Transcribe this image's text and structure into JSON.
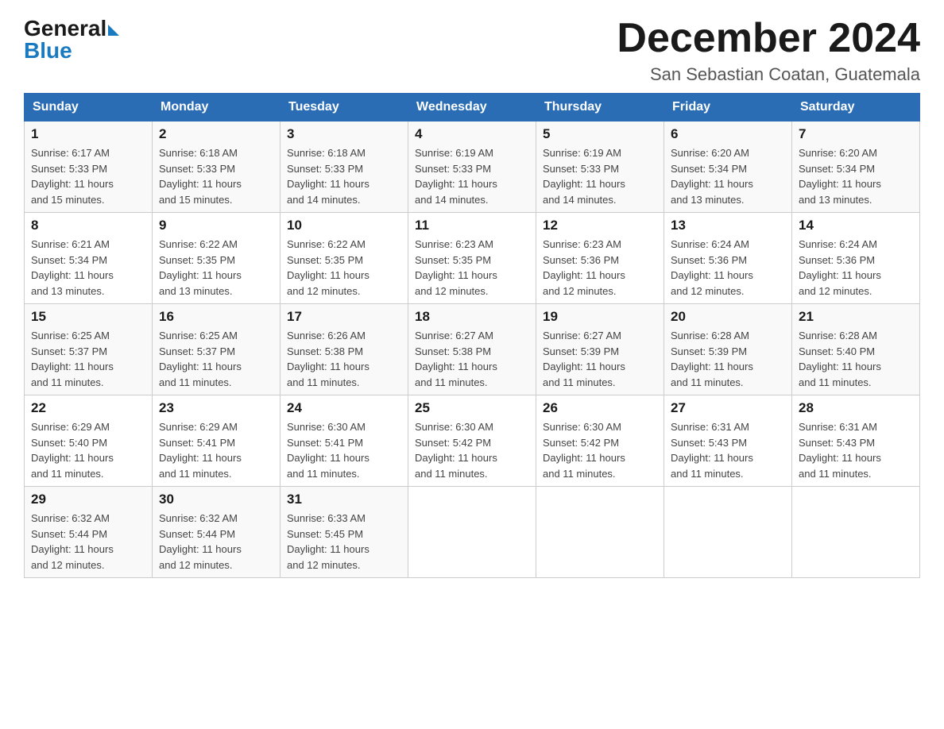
{
  "logo": {
    "general": "General",
    "blue": "Blue"
  },
  "title": "December 2024",
  "subtitle": "San Sebastian Coatan, Guatemala",
  "days_of_week": [
    "Sunday",
    "Monday",
    "Tuesday",
    "Wednesday",
    "Thursday",
    "Friday",
    "Saturday"
  ],
  "weeks": [
    [
      {
        "day": "1",
        "sunrise": "6:17 AM",
        "sunset": "5:33 PM",
        "daylight": "11 hours and 15 minutes."
      },
      {
        "day": "2",
        "sunrise": "6:18 AM",
        "sunset": "5:33 PM",
        "daylight": "11 hours and 15 minutes."
      },
      {
        "day": "3",
        "sunrise": "6:18 AM",
        "sunset": "5:33 PM",
        "daylight": "11 hours and 14 minutes."
      },
      {
        "day": "4",
        "sunrise": "6:19 AM",
        "sunset": "5:33 PM",
        "daylight": "11 hours and 14 minutes."
      },
      {
        "day": "5",
        "sunrise": "6:19 AM",
        "sunset": "5:33 PM",
        "daylight": "11 hours and 14 minutes."
      },
      {
        "day": "6",
        "sunrise": "6:20 AM",
        "sunset": "5:34 PM",
        "daylight": "11 hours and 13 minutes."
      },
      {
        "day": "7",
        "sunrise": "6:20 AM",
        "sunset": "5:34 PM",
        "daylight": "11 hours and 13 minutes."
      }
    ],
    [
      {
        "day": "8",
        "sunrise": "6:21 AM",
        "sunset": "5:34 PM",
        "daylight": "11 hours and 13 minutes."
      },
      {
        "day": "9",
        "sunrise": "6:22 AM",
        "sunset": "5:35 PM",
        "daylight": "11 hours and 13 minutes."
      },
      {
        "day": "10",
        "sunrise": "6:22 AM",
        "sunset": "5:35 PM",
        "daylight": "11 hours and 12 minutes."
      },
      {
        "day": "11",
        "sunrise": "6:23 AM",
        "sunset": "5:35 PM",
        "daylight": "11 hours and 12 minutes."
      },
      {
        "day": "12",
        "sunrise": "6:23 AM",
        "sunset": "5:36 PM",
        "daylight": "11 hours and 12 minutes."
      },
      {
        "day": "13",
        "sunrise": "6:24 AM",
        "sunset": "5:36 PM",
        "daylight": "11 hours and 12 minutes."
      },
      {
        "day": "14",
        "sunrise": "6:24 AM",
        "sunset": "5:36 PM",
        "daylight": "11 hours and 12 minutes."
      }
    ],
    [
      {
        "day": "15",
        "sunrise": "6:25 AM",
        "sunset": "5:37 PM",
        "daylight": "11 hours and 11 minutes."
      },
      {
        "day": "16",
        "sunrise": "6:25 AM",
        "sunset": "5:37 PM",
        "daylight": "11 hours and 11 minutes."
      },
      {
        "day": "17",
        "sunrise": "6:26 AM",
        "sunset": "5:38 PM",
        "daylight": "11 hours and 11 minutes."
      },
      {
        "day": "18",
        "sunrise": "6:27 AM",
        "sunset": "5:38 PM",
        "daylight": "11 hours and 11 minutes."
      },
      {
        "day": "19",
        "sunrise": "6:27 AM",
        "sunset": "5:39 PM",
        "daylight": "11 hours and 11 minutes."
      },
      {
        "day": "20",
        "sunrise": "6:28 AM",
        "sunset": "5:39 PM",
        "daylight": "11 hours and 11 minutes."
      },
      {
        "day": "21",
        "sunrise": "6:28 AM",
        "sunset": "5:40 PM",
        "daylight": "11 hours and 11 minutes."
      }
    ],
    [
      {
        "day": "22",
        "sunrise": "6:29 AM",
        "sunset": "5:40 PM",
        "daylight": "11 hours and 11 minutes."
      },
      {
        "day": "23",
        "sunrise": "6:29 AM",
        "sunset": "5:41 PM",
        "daylight": "11 hours and 11 minutes."
      },
      {
        "day": "24",
        "sunrise": "6:30 AM",
        "sunset": "5:41 PM",
        "daylight": "11 hours and 11 minutes."
      },
      {
        "day": "25",
        "sunrise": "6:30 AM",
        "sunset": "5:42 PM",
        "daylight": "11 hours and 11 minutes."
      },
      {
        "day": "26",
        "sunrise": "6:30 AM",
        "sunset": "5:42 PM",
        "daylight": "11 hours and 11 minutes."
      },
      {
        "day": "27",
        "sunrise": "6:31 AM",
        "sunset": "5:43 PM",
        "daylight": "11 hours and 11 minutes."
      },
      {
        "day": "28",
        "sunrise": "6:31 AM",
        "sunset": "5:43 PM",
        "daylight": "11 hours and 11 minutes."
      }
    ],
    [
      {
        "day": "29",
        "sunrise": "6:32 AM",
        "sunset": "5:44 PM",
        "daylight": "11 hours and 12 minutes."
      },
      {
        "day": "30",
        "sunrise": "6:32 AM",
        "sunset": "5:44 PM",
        "daylight": "11 hours and 12 minutes."
      },
      {
        "day": "31",
        "sunrise": "6:33 AM",
        "sunset": "5:45 PM",
        "daylight": "11 hours and 12 minutes."
      },
      null,
      null,
      null,
      null
    ]
  ],
  "labels": {
    "sunrise": "Sunrise:",
    "sunset": "Sunset:",
    "daylight": "Daylight:"
  }
}
